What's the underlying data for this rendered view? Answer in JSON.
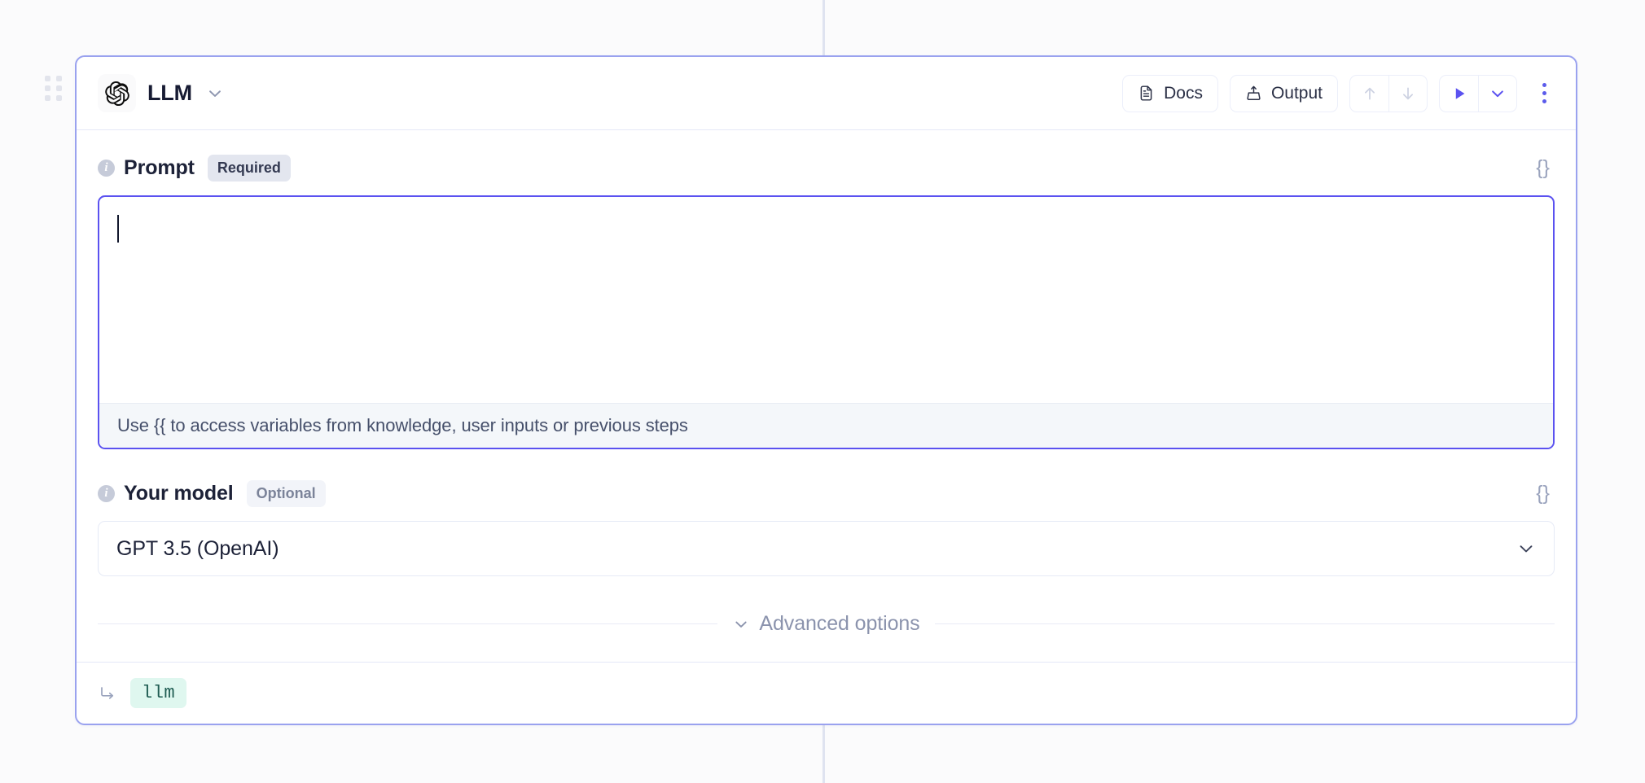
{
  "canvas": {
    "background_color": "#fbfbfc",
    "connector_color": "#dfe3f0"
  },
  "node": {
    "drag_handle_name": "drag-handle",
    "border_color": "#9aa2ef",
    "header": {
      "provider_icon": "openai-logo-icon",
      "title": "LLM",
      "title_caret_icon": "chevron-down-icon",
      "buttons": [
        {
          "id": "docs",
          "label": "Docs",
          "icon": "document-icon"
        },
        {
          "id": "output",
          "label": "Output",
          "icon": "export-upload-icon"
        }
      ],
      "nav_group": [
        {
          "id": "move-up",
          "icon": "arrow-up-icon",
          "disabled": true
        },
        {
          "id": "move-down",
          "icon": "arrow-down-icon",
          "disabled": true
        }
      ],
      "run_group": [
        {
          "id": "run",
          "icon": "play-icon",
          "color": "#5b52f0"
        },
        {
          "id": "run-options",
          "icon": "chevron-down-icon",
          "color": "#5b52f0"
        }
      ],
      "more_menu_icon": "kebab-menu-icon",
      "accent_color": "#5b52f0"
    },
    "fields": {
      "prompt": {
        "label": "Prompt",
        "badge": "Required",
        "info_icon": "info-icon",
        "braces_icon": "curly-braces-icon",
        "value": "",
        "placeholder": "",
        "hint": "Use {{ to access variables from knowledge, user inputs or previous steps",
        "focused": true
      },
      "model": {
        "label": "Your model",
        "badge": "Optional",
        "info_icon": "info-icon",
        "braces_icon": "curly-braces-icon",
        "selected": "GPT 3.5 (OpenAI)",
        "caret_icon": "chevron-down-icon"
      }
    },
    "advanced": {
      "label": "Advanced options",
      "caret_icon": "chevron-down-icon",
      "expanded": false
    },
    "footer": {
      "arrow_icon": "arrow-turn-down-right-icon",
      "output_variable": "llm"
    }
  }
}
